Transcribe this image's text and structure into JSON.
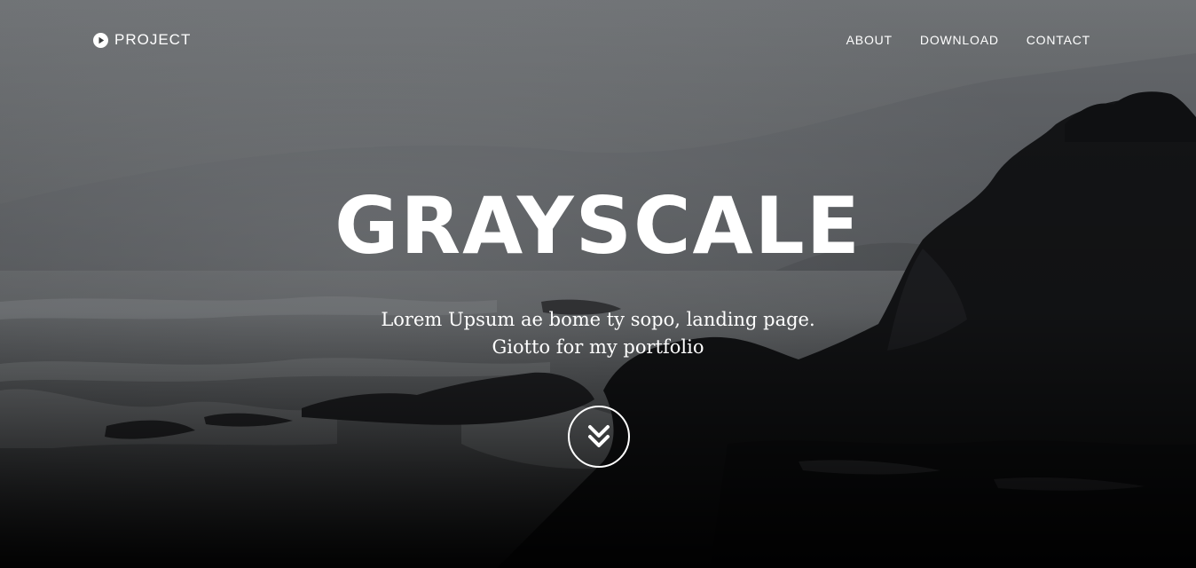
{
  "navbar": {
    "brand": {
      "label": "PROJECT",
      "icon": "play-circle-icon"
    },
    "links": [
      {
        "label": "ABOUT"
      },
      {
        "label": "DOWNLOAD"
      },
      {
        "label": "CONTACT"
      }
    ]
  },
  "hero": {
    "title": "GRAYSCALE",
    "tagline_line1": "Lorem Upsum ae bome ty sopo, landing page.",
    "tagline_line2": "Giotto for my portfolio",
    "scroll_icon": "double-chevron-down-icon"
  },
  "colors": {
    "text": "#ffffff",
    "sky": "#6a6d70",
    "cliff": "#131416",
    "overlay_bottom": "#000000"
  }
}
